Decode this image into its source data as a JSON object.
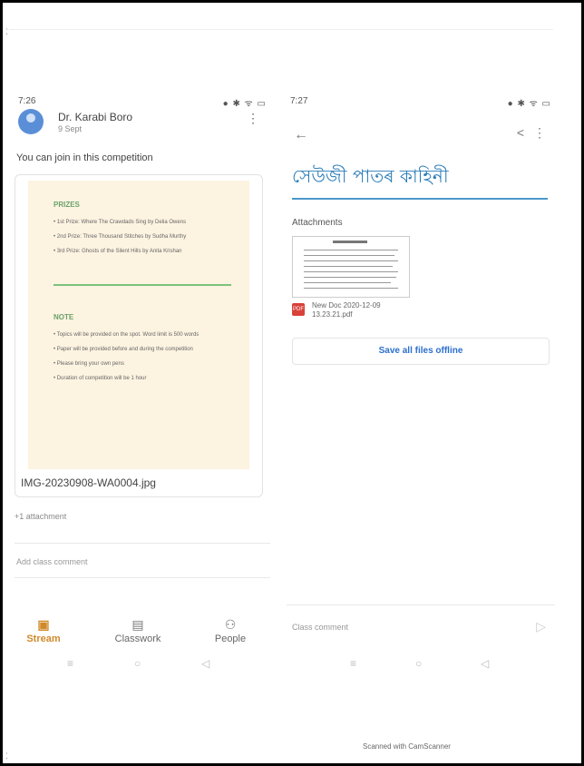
{
  "left": {
    "status_time": "7:26",
    "status_icons": "● ✱ ᯤ ▭",
    "author": "Dr. Karabi Boro",
    "post_date": "9 Sept",
    "post_text": "You can join in this competition",
    "doc": {
      "prizes_heading": "PRIZES",
      "prizes": [
        "1st Prize: Where The Crawdads Sing by Delia Owens",
        "2nd Prize: Three Thousand Stitches by Sudha Murthy",
        "3rd Prize: Ghosts of the Silent Hills by Anita Krishan"
      ],
      "note_heading": "NOTE",
      "notes": [
        "Topics will be provided on the spot. Word limit is 500 words",
        "Paper will be provided before and during the competition",
        "Please bring your own pens",
        "Duration of competition will be 1 hour"
      ]
    },
    "attachment_name": "IMG-20230908-WA0004.jpg",
    "more_attachments": "+1 attachment",
    "class_comment_placeholder": "Add class comment",
    "bottom_nav": [
      {
        "label": "Stream",
        "icon": "stream-icon"
      },
      {
        "label": "Classwork",
        "icon": "classwork-icon"
      },
      {
        "label": "People",
        "icon": "people-icon"
      }
    ],
    "sysnav": [
      "≡",
      "○",
      "◁"
    ]
  },
  "right": {
    "status_time": "7:27",
    "status_icons": "● ✱ ᯤ ▭",
    "title": "সেউজী পাতৰ কাহিনী",
    "attachments_heading": "Attachments",
    "file_name": "New Doc 2020-12-09 13.23.21.pdf",
    "pdf_label": "PDF",
    "save_button": "Save all files offline",
    "class_comment_placeholder": "Class comment",
    "sysnav": [
      "≡",
      "○",
      "◁"
    ]
  },
  "footer": "Scanned with CamScanner",
  "colors": {
    "accent_orange": "#d08a2b",
    "title_blue": "#2c7db8",
    "button_blue": "#2b6fcf",
    "doc_background": "#fdf3e1",
    "pdf_red": "#d9423a"
  }
}
